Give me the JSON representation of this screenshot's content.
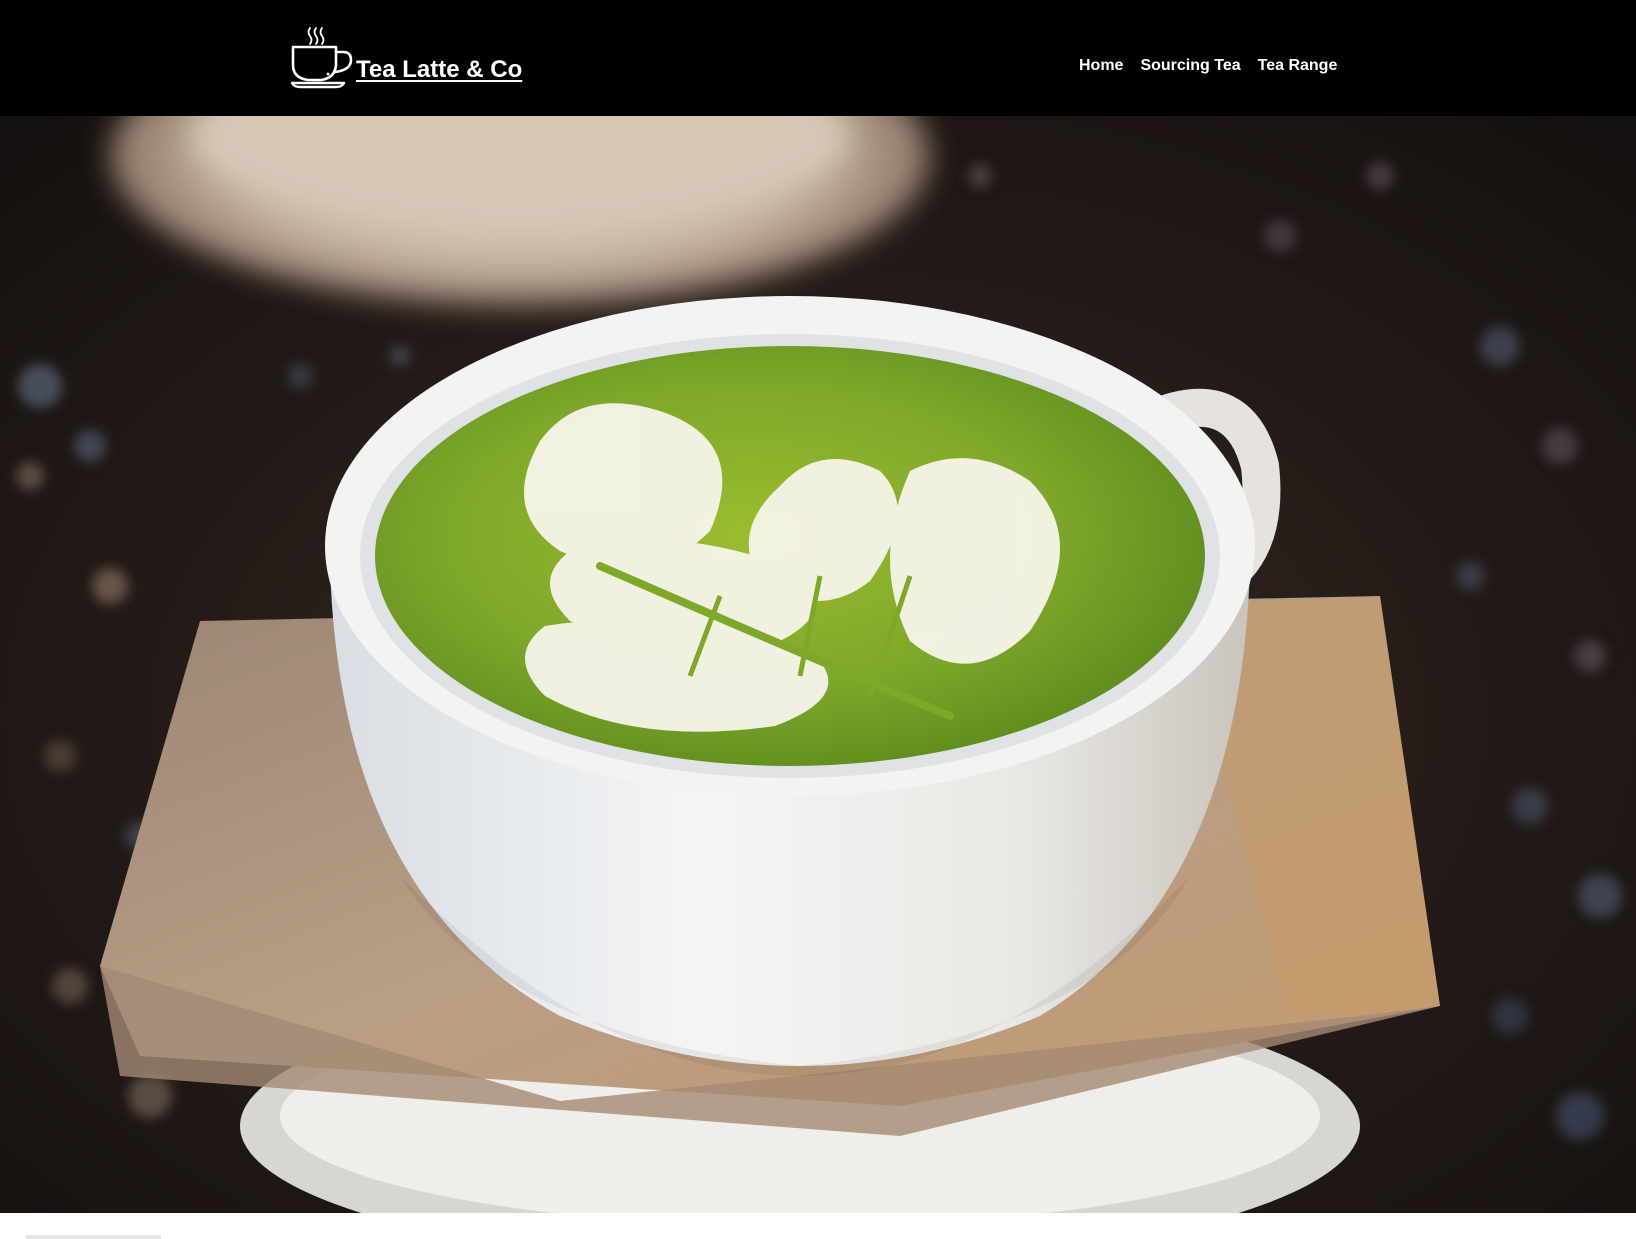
{
  "header": {
    "brand": {
      "name": "Tea Latte & Co",
      "logo_icon": "steaming-teacup-icon"
    },
    "nav": {
      "items": [
        {
          "label": "Home"
        },
        {
          "label": "Sourcing Tea"
        },
        {
          "label": "Tea Range"
        }
      ]
    }
  },
  "hero": {
    "image_subject": "matcha-latte-photo"
  },
  "colors": {
    "header_bg": "#000000",
    "header_text": "#ffffff",
    "matcha_green": "#7ea82a",
    "page_bg": "#ffffff"
  }
}
